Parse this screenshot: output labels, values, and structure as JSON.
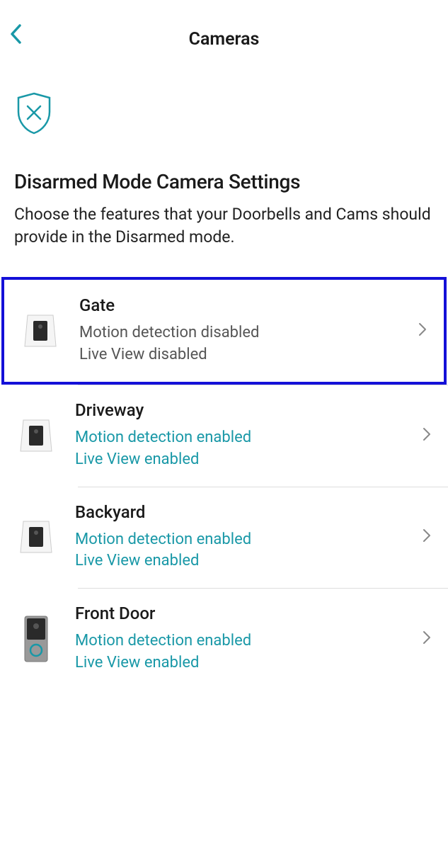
{
  "header": {
    "title": "Cameras"
  },
  "page": {
    "title": "Disarmed Mode Camera Settings",
    "subtitle": "Choose the features that your Doorbells and Cams should provide in the Disarmed mode."
  },
  "cameras": [
    {
      "name": "Gate",
      "motion_status": "Motion detection disabled",
      "liveview_status": "Live View disabled",
      "enabled": false,
      "highlighted": true,
      "device_type": "camera"
    },
    {
      "name": "Driveway",
      "motion_status": "Motion detection enabled",
      "liveview_status": "Live View enabled",
      "enabled": true,
      "highlighted": false,
      "device_type": "camera"
    },
    {
      "name": "Backyard",
      "motion_status": "Motion detection enabled",
      "liveview_status": "Live View enabled",
      "enabled": true,
      "highlighted": false,
      "device_type": "camera"
    },
    {
      "name": "Front Door",
      "motion_status": "Motion detection enabled",
      "liveview_status": "Live View enabled",
      "enabled": true,
      "highlighted": false,
      "device_type": "doorbell"
    }
  ],
  "colors": {
    "accent": "#1998a7",
    "highlight_border": "#1410d8",
    "text_primary": "#1a1a1a",
    "text_muted": "#555"
  }
}
